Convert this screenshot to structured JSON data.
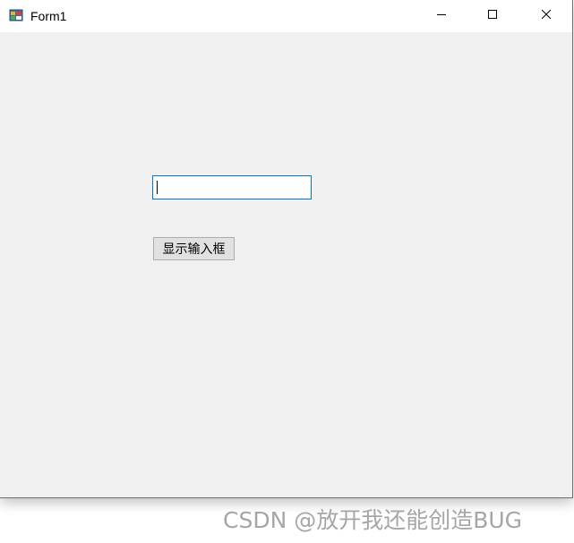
{
  "window": {
    "title": "Form1",
    "icon": "winforms-app-icon",
    "controls": {
      "minimize_icon": "minimize-icon",
      "maximize_icon": "maximize-icon",
      "close_icon": "close-icon"
    }
  },
  "form": {
    "textbox_value": "",
    "button_label": "显示输入框"
  },
  "watermark": {
    "text": "CSDN @放开我还能创造BUG"
  },
  "colors": {
    "client_background": "#f0f0f0",
    "titlebar_background": "#ffffff",
    "textbox_focus_border": "#0078d7",
    "button_face": "#e1e1e1",
    "button_border": "#adadad",
    "watermark_text": "#a6a6a6"
  }
}
